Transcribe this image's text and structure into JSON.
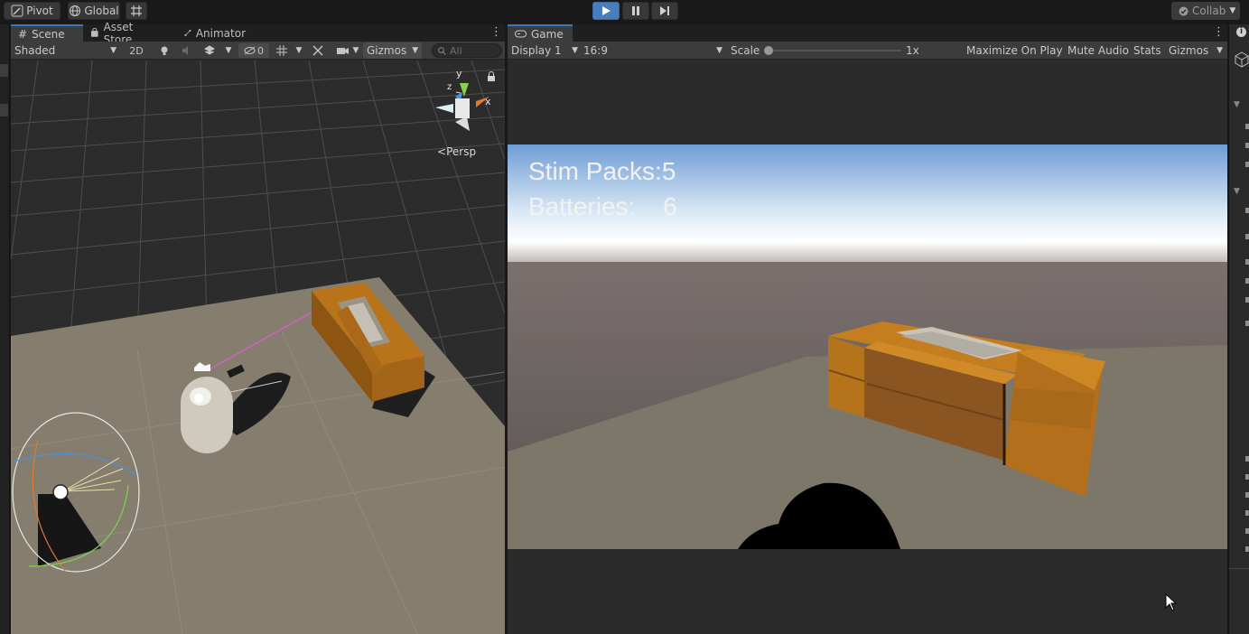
{
  "toolbar": {
    "pivot_label": "Pivot",
    "global_label": "Global",
    "collab_label": "Collab"
  },
  "scene": {
    "tabs": [
      {
        "label": "Scene"
      },
      {
        "label": "Asset Store"
      },
      {
        "label": "Animator"
      }
    ],
    "shading_mode": "Shaded",
    "mode_2d_label": "2D",
    "hidden_count": "0",
    "gizmos_label": "Gizmos",
    "search_placeholder": "All",
    "persp_label": "Persp",
    "axis_y": "y",
    "axis_x": "x",
    "axis_z": "z"
  },
  "game": {
    "tab_label": "Game",
    "display_label": "Display 1",
    "aspect_label": "16:9",
    "scale_label": "Scale",
    "scale_value_label": "1x",
    "scale_value": 1,
    "maximize_label": "Maximize On Play",
    "mute_label": "Mute Audio",
    "stats_label": "Stats",
    "gizmos_label": "Gizmos",
    "hud": {
      "stim_label": "Stim Packs:",
      "stim_value": "5",
      "battery_label": "Batteries:",
      "battery_value": "6"
    }
  },
  "colors": {
    "accent": "#4a7dbd",
    "tab_highlight": "#3a79bb",
    "crate": "#c27f22",
    "ground": "#8a8272"
  }
}
